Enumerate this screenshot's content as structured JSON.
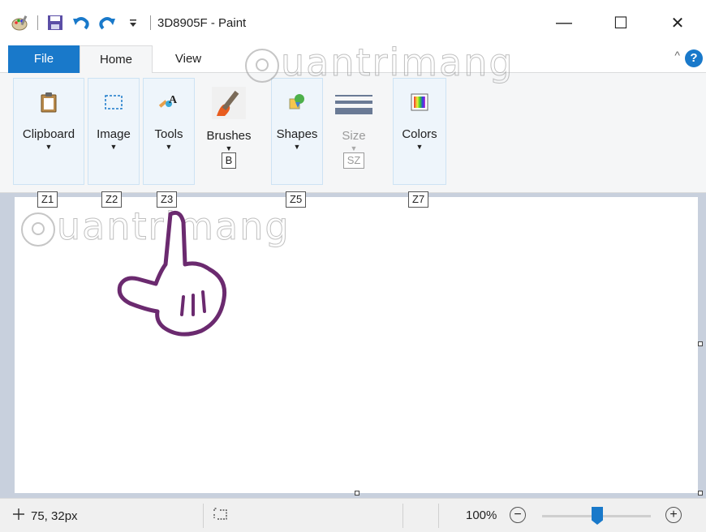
{
  "window": {
    "title": "3D8905F - Paint",
    "minimize": "—",
    "maximize": "☐",
    "close": "✕"
  },
  "qat": {
    "icons": [
      "paint-app-icon",
      "save-icon",
      "undo-icon",
      "redo-icon",
      "customize-qat-icon"
    ]
  },
  "tabs": {
    "file": "File",
    "home": "Home",
    "view": "View",
    "collapse": "^",
    "help": "?"
  },
  "ribbon": {
    "groups": [
      {
        "label": "Clipboard",
        "icon": "clipboard-icon",
        "keytip": "Z1",
        "caret": "▼"
      },
      {
        "label": "Image",
        "icon": "select-icon",
        "keytip": "Z2",
        "caret": "▼"
      },
      {
        "label": "Tools",
        "icon": "tools-icon",
        "keytip": "Z3",
        "caret": "▼"
      },
      {
        "label": "Brushes",
        "icon": "brush-icon",
        "keytip": "B",
        "caret": "▼"
      },
      {
        "label": "Shapes",
        "icon": "shapes-icon",
        "keytip": "Z5",
        "caret": "▼"
      },
      {
        "label": "Size",
        "icon": "size-icon",
        "keytip": "SZ",
        "caret": "▼"
      },
      {
        "label": "Colors",
        "icon": "colors-icon",
        "keytip": "Z7",
        "caret": "▼"
      }
    ]
  },
  "watermark": {
    "text1": "uantrimang",
    "text2": "uantrimang"
  },
  "status": {
    "position": "75, 32px",
    "zoom": "100%",
    "zoom_minus": "−",
    "zoom_plus": "+"
  },
  "colors": {
    "accent": "#1979ca",
    "ribbon_bg": "#f5f6f7",
    "group_bg": "#eef5fb",
    "workspace": "#c8d0dd"
  }
}
